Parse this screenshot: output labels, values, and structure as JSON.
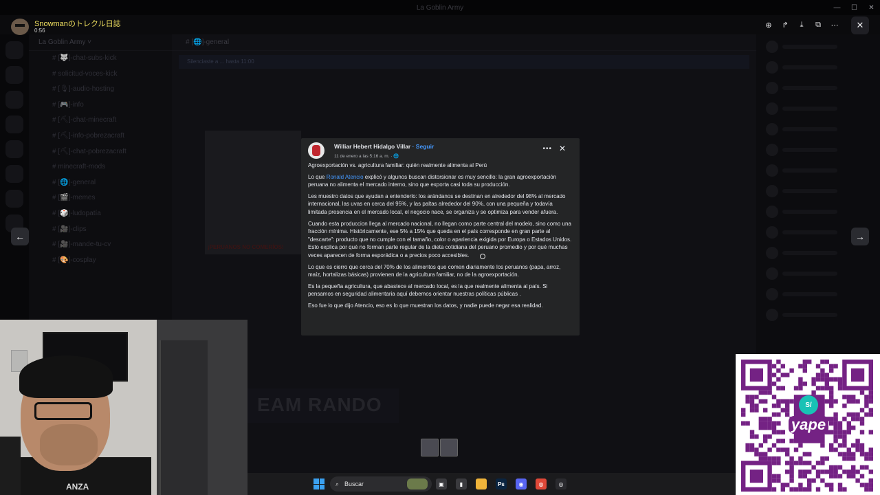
{
  "window": {
    "title": "La Goblin Army"
  },
  "viewer": {
    "user_name": "Snowmanのトレクル日誌",
    "timestamp": "0:56",
    "tools": [
      {
        "name": "zoom-icon",
        "glyph": "⊕"
      },
      {
        "name": "forward-icon",
        "glyph": "↱"
      },
      {
        "name": "download-icon",
        "glyph": "⤓"
      },
      {
        "name": "open-external-icon",
        "glyph": "⧉"
      },
      {
        "name": "more-icon",
        "glyph": "⋯"
      }
    ],
    "close_glyph": "✕",
    "prev_glyph": "←",
    "next_glyph": "→"
  },
  "discord": {
    "server_name": "La Goblin Army ˅",
    "channel_header": "#  [🌐]-general",
    "banner_text": "Silenciaste a ... hasta 11:00",
    "channels": [
      {
        "label": "#  [🐺]-chat-subs-kick",
        "category": false
      },
      {
        "label": "#  solicitud-voces-kick",
        "category": false
      },
      {
        "label": "#  [🎙]-audio-hosting",
        "category": false
      },
      {
        "label": "#  [🎮]-info",
        "category": false
      },
      {
        "label": "#  [⛏]-chat-minecraft",
        "category": false
      },
      {
        "label": "#  [⛏]-info-pobrezacraft",
        "category": false
      },
      {
        "label": "#  [⛏]-chat-pobrezacraft",
        "category": false
      },
      {
        "label": "#  minecraft-mods",
        "category": false
      },
      {
        "label": "#  [🌐]-general",
        "category": false
      },
      {
        "label": "#  [🎬]-memes",
        "category": false
      },
      {
        "label": "#  [🎲]-ludopatía",
        "category": false
      },
      {
        "label": "#  [🎥]-clips",
        "category": false
      },
      {
        "label": "#  [🎥]-mande-tu-cv",
        "category": false
      },
      {
        "label": "#  [🎨]-cosplay",
        "category": false
      }
    ],
    "bg_image_caption": "¡PERUANOS NO COMERÍOS!",
    "rando_text": "EAM RANDO"
  },
  "post": {
    "author": "Williar Hebert Hidalgo Villar",
    "follow_label": " · Seguir",
    "meta": "11 de enero a las 5:16 a. m. · 🌐",
    "more_glyph": "•••",
    "close_glyph": "✕",
    "title": "Agroexportación vs. agricultura familiar: quién realmente alimenta al Perú",
    "p1_before": "Lo que ",
    "p1_mention": "Ronald Atencio",
    "p1_after": " explicó y algunos buscan distorsionar es muy sencillo: la gran agroexportación peruana no alimenta el mercado interno, sino que exporta casi toda su producción.",
    "p2": "Les muestro datos que ayudan a entenderlo: los arándanos se destinan en alrededor del 98% al mercado internacional, las uvas en cerca del 95%, y las paltas alrededor del 90%, con una pequeña y todavía limitada presencia en el mercado local, el negocio nace, se organiza y se optimiza para vender afuera.",
    "p3": "Cuando esta produccion llega al mercado nacional, no llegan como parte central del modelo, sino como una fracción mínima. Históricamente, ese 5% a 15% que queda en el país corresponde en gran parte al \"descarte\": producto que no cumple con el tamaño, color o apariencia exigida por Europa o Estados Unidos. Esto explica por qué no forman parte regular de la dieta cotidiana del peruano promedio y por qué muchas veces aparecen de forma esporádica o a precios poco accesibles.",
    "p4": "Lo que es cierro que cerca del 70% de los alimentos que comen diariamente los peruanos (papa, arroz, maíz, hortalizas básicas) provienen de la agricultura familiar, no de la agroexportación.",
    "p5": "Es la pequeña agricultura, que abastece al mercado local, es la que realmente alimenta al país. Si pensamos en seguridad alimentaria aquí debemos orientar nuestras políticas públicas .",
    "p6": "Eso fue lo que dijo Atencio, eso es lo que muestran los datos, y nadie puede negar esa realidad."
  },
  "webcam": {
    "shirt_text": "ANZA"
  },
  "qr": {
    "currency": "S/",
    "brand": "yape",
    "brand_color": "#742284",
    "accent_color": "#19c2b5"
  },
  "taskbar": {
    "search_placeholder": "Buscar",
    "apps": [
      {
        "name": "task-view-icon",
        "label": "▣",
        "color": "#3a3a3e"
      },
      {
        "name": "usb-icon",
        "label": "▮",
        "color": "#3a3a3e"
      },
      {
        "name": "file-explorer-icon",
        "label": "",
        "color": "#f0b43a"
      },
      {
        "name": "photoshop-icon",
        "label": "Ps",
        "color": "#0a2440"
      },
      {
        "name": "discord-icon",
        "label": "◉",
        "color": "#5865f2"
      },
      {
        "name": "chrome-icon",
        "label": "◍",
        "color": "#e04838"
      },
      {
        "name": "obs-icon",
        "label": "◎",
        "color": "#2a2a2e"
      }
    ]
  }
}
